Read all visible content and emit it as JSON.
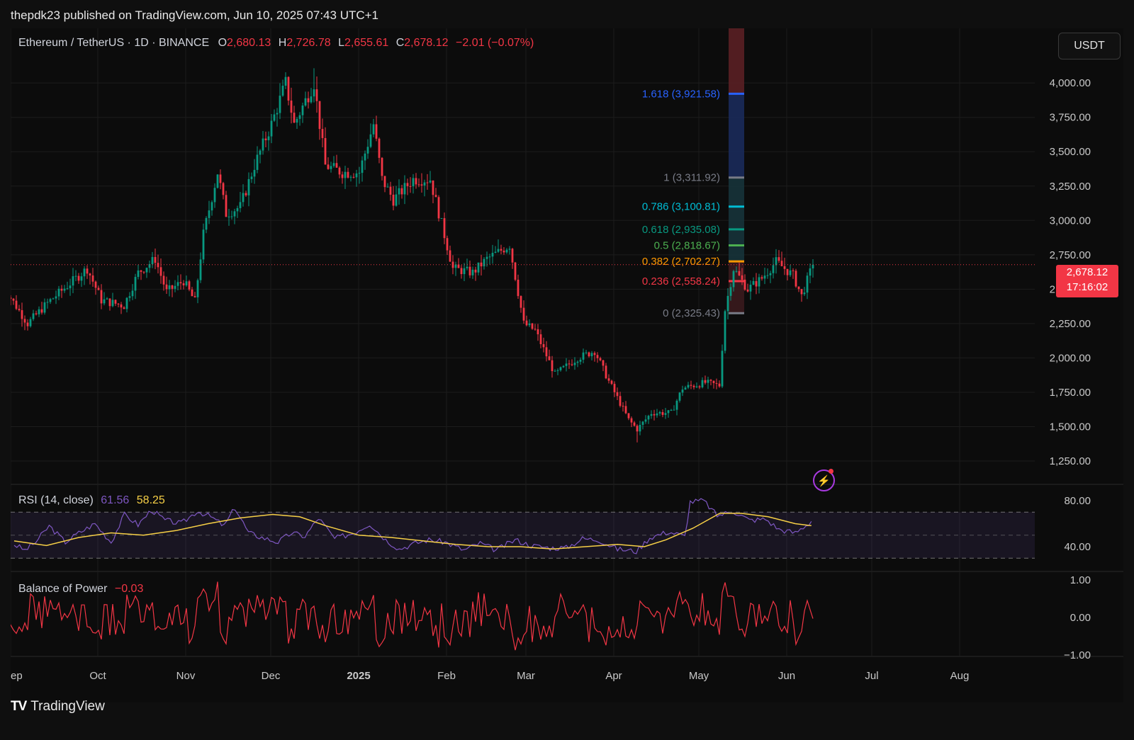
{
  "publisher_line": "thepdk23 published on TradingView.com, Jun 10, 2025 07:43 UTC+1",
  "legend": {
    "symbol": "Ethereum / TetherUS · 1D · BINANCE",
    "o_label": "O",
    "o": "2,680.13",
    "h_label": "H",
    "h": "2,726.78",
    "l_label": "L",
    "l": "2,655.61",
    "c_label": "C",
    "c": "2,678.12",
    "change": "−2.01 (−0.07%)"
  },
  "currency_button": "USDT",
  "last_price": {
    "value": "2,678.12",
    "countdown": "17:16:02"
  },
  "rsi_panel": {
    "title": "RSI (14, close)",
    "rsi": "61.56",
    "ma": "58.25"
  },
  "bop_panel": {
    "title": "Balance of Power",
    "value": "−0.03"
  },
  "footer_brand": "TradingView",
  "colors": {
    "up": "#089981",
    "down": "#f23645",
    "rsi": "#7e57c2",
    "rsi_ma": "#f7d046",
    "bop": "#f23645",
    "background": "#0c0c0c"
  },
  "chart_data": [
    {
      "type": "candlestick",
      "title": "Ethereum / TetherUS · 1D · BINANCE",
      "x_ticks": [
        "ep",
        "Oct",
        "Nov",
        "Dec",
        "2025",
        "Feb",
        "Mar",
        "Apr",
        "May",
        "Jun",
        "Jul",
        "Aug"
      ],
      "y_ticks": [
        "1,250.00",
        "1,500.00",
        "1,750.00",
        "2,000.00",
        "2,250.00",
        "2,500.00",
        "2,750.00",
        "3,000.00",
        "3,250.00",
        "3,500.00",
        "3,750.00",
        "4,000.00"
      ],
      "ylim": [
        1150,
        4250
      ],
      "last_close": 2678.12,
      "close_path": [
        [
          "2024-08-28",
          2530
        ],
        [
          "2024-09-06",
          2250
        ],
        [
          "2024-09-13",
          2400
        ],
        [
          "2024-09-27",
          2650
        ],
        [
          "2024-10-02",
          2420
        ],
        [
          "2024-10-10",
          2380
        ],
        [
          "2024-10-15",
          2620
        ],
        [
          "2024-10-21",
          2720
        ],
        [
          "2024-10-25",
          2480
        ],
        [
          "2024-10-31",
          2560
        ],
        [
          "2024-11-04",
          2410
        ],
        [
          "2024-11-07",
          2900
        ],
        [
          "2024-11-12",
          3350
        ],
        [
          "2024-11-15",
          3050
        ],
        [
          "2024-11-20",
          3100
        ],
        [
          "2024-11-25",
          3400
        ],
        [
          "2024-12-01",
          3700
        ],
        [
          "2024-12-06",
          4000
        ],
        [
          "2024-12-09",
          3700
        ],
        [
          "2024-12-16",
          4000
        ],
        [
          "2024-12-20",
          3400
        ],
        [
          "2024-12-26",
          3350
        ],
        [
          "2025-01-01",
          3350
        ],
        [
          "2025-01-06",
          3700
        ],
        [
          "2025-01-09",
          3300
        ],
        [
          "2025-01-13",
          3150
        ],
        [
          "2025-01-20",
          3300
        ],
        [
          "2025-01-26",
          3300
        ],
        [
          "2025-02-03",
          2650
        ],
        [
          "2025-02-10",
          2620
        ],
        [
          "2025-02-15",
          2720
        ],
        [
          "2025-02-23",
          2820
        ],
        [
          "2025-02-28",
          2250
        ],
        [
          "2025-03-04",
          2200
        ],
        [
          "2025-03-11",
          1880
        ],
        [
          "2025-03-19",
          2000
        ],
        [
          "2025-03-25",
          2050
        ],
        [
          "2025-03-30",
          1830
        ],
        [
          "2025-04-06",
          1550
        ],
        [
          "2025-04-09",
          1480
        ],
        [
          "2025-04-14",
          1600
        ],
        [
          "2025-04-21",
          1600
        ],
        [
          "2025-04-25",
          1780
        ],
        [
          "2025-05-03",
          1820
        ],
        [
          "2025-05-08",
          1800
        ],
        [
          "2025-05-10",
          2350
        ],
        [
          "2025-05-13",
          2650
        ],
        [
          "2025-05-18",
          2500
        ],
        [
          "2025-05-23",
          2580
        ],
        [
          "2025-05-28",
          2700
        ],
        [
          "2025-06-03",
          2600
        ],
        [
          "2025-06-06",
          2450
        ],
        [
          "2025-06-10",
          2678.12
        ]
      ],
      "extremes": {
        "high": 4107,
        "high_date": "2024-12-16",
        "low": 1385,
        "low_date": "2025-04-09"
      },
      "fibonacci": [
        {
          "level": "1.618",
          "price": 3921.58,
          "label": "1.618 (3,921.58)",
          "color": "#2962ff"
        },
        {
          "level": "1",
          "price": 3311.92,
          "label": "1 (3,311.92)",
          "color": "#787b86"
        },
        {
          "level": "0.786",
          "price": 3100.81,
          "label": "0.786 (3,100.81)",
          "color": "#00bcd4"
        },
        {
          "level": "0.618",
          "price": 2935.08,
          "label": "0.618 (2,935.08)",
          "color": "#089981"
        },
        {
          "level": "0.5",
          "price": 2818.67,
          "label": "0.5 (2,818.67)",
          "color": "#4caf50"
        },
        {
          "level": "0.382",
          "price": 2702.27,
          "label": "0.382 (2,702.27)",
          "color": "#ff9800"
        },
        {
          "level": "0.236",
          "price": 2558.24,
          "label": "0.236 (2,558.24)",
          "color": "#f23645"
        },
        {
          "level": "0",
          "price": 2325.43,
          "label": "0 (2,325.43)",
          "color": "#787b86"
        }
      ]
    },
    {
      "type": "line",
      "title": "RSI (14, close)",
      "y_ticks": [
        "40.00",
        "80.00"
      ],
      "ylim": [
        20,
        90
      ],
      "bands": [
        70,
        50,
        30
      ],
      "series": [
        {
          "name": "RSI",
          "color": "#7e57c2",
          "points": [
            [
              0,
              42
            ],
            [
              4,
              37
            ],
            [
              8,
              44
            ],
            [
              13,
              58
            ],
            [
              19,
              44
            ],
            [
              24,
              52
            ],
            [
              30,
              60
            ],
            [
              36,
              44
            ],
            [
              41,
              68
            ],
            [
              46,
              59
            ],
            [
              51,
              72
            ],
            [
              56,
              63
            ],
            [
              62,
              60
            ],
            [
              68,
              71
            ],
            [
              73,
              66
            ],
            [
              78,
              58
            ],
            [
              82,
              74
            ],
            [
              87,
              52
            ],
            [
              92,
              48
            ],
            [
              98,
              44
            ],
            [
              103,
              52
            ],
            [
              108,
              49
            ],
            [
              113,
              65
            ],
            [
              119,
              47
            ],
            [
              126,
              52
            ],
            [
              132,
              60
            ],
            [
              138,
              46
            ],
            [
              143,
              38
            ],
            [
              149,
              43
            ],
            [
              154,
              46
            ],
            [
              160,
              44
            ],
            [
              167,
              37
            ],
            [
              173,
              43
            ],
            [
              179,
              37
            ],
            [
              186,
              46
            ],
            [
              192,
              41
            ],
            [
              199,
              39
            ],
            [
              205,
              39
            ],
            [
              211,
              47
            ],
            [
              217,
              46
            ],
            [
              224,
              38
            ],
            [
              231,
              36
            ],
            [
              236,
              48
            ],
            [
              243,
              53
            ],
            [
              249,
              49
            ],
            [
              251,
              79
            ],
            [
              256,
              80
            ],
            [
              261,
              67
            ],
            [
              267,
              71
            ],
            [
              273,
              63
            ],
            [
              279,
              64
            ],
            [
              284,
              55
            ],
            [
              290,
              52
            ],
            [
              296,
              62
            ]
          ]
        },
        {
          "name": "MA",
          "color": "#f7d046",
          "points": [
            [
              0,
              45
            ],
            [
              12,
              41
            ],
            [
              24,
              48
            ],
            [
              36,
              52
            ],
            [
              48,
              50
            ],
            [
              60,
              54
            ],
            [
              72,
              60
            ],
            [
              84,
              65
            ],
            [
              96,
              68
            ],
            [
              106,
              66
            ],
            [
              116,
              58
            ],
            [
              128,
              50
            ],
            [
              140,
              48
            ],
            [
              152,
              45
            ],
            [
              164,
              42
            ],
            [
              176,
              40
            ],
            [
              188,
              40
            ],
            [
              200,
              38
            ],
            [
              212,
              40
            ],
            [
              224,
              42
            ],
            [
              234,
              40
            ],
            [
              242,
              46
            ],
            [
              252,
              56
            ],
            [
              262,
              69
            ],
            [
              270,
              69
            ],
            [
              280,
              66
            ],
            [
              290,
              60
            ],
            [
              296,
              58.25
            ]
          ]
        }
      ]
    },
    {
      "type": "line",
      "title": "Balance of Power",
      "y_ticks": [
        "1.00",
        "0.00",
        "−1.00"
      ],
      "ylim": [
        -1.15,
        1.15
      ],
      "series": [
        {
          "name": "Balance of Power",
          "color": "#f23645",
          "last_value": -0.03
        }
      ]
    }
  ]
}
